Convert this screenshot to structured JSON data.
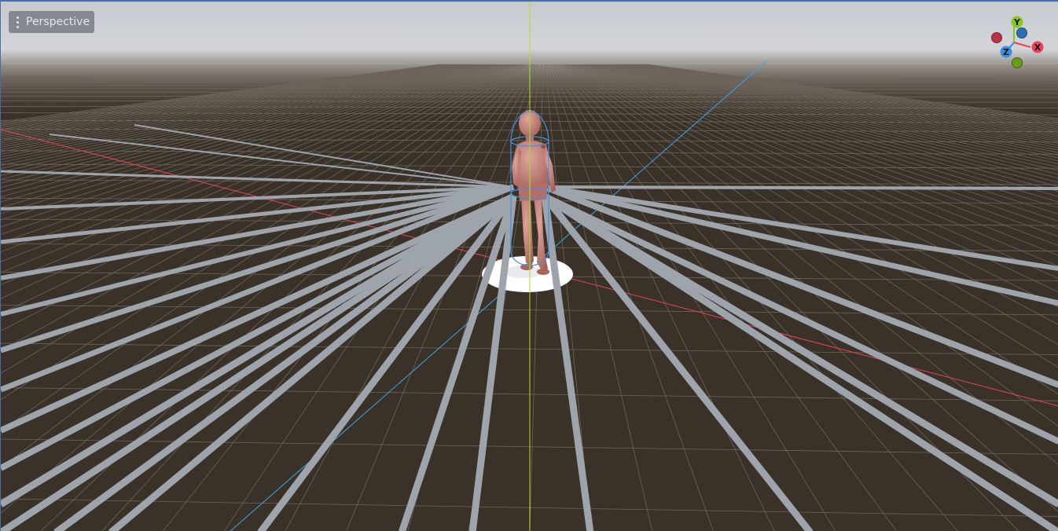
{
  "viewport": {
    "view_menu_label": "Perspective"
  },
  "gizmo": {
    "x_label": "X",
    "y_label": "Y",
    "z_label": "Z",
    "colors": {
      "x": "#e8435a",
      "y": "#8cc425",
      "z": "#3b8fe0",
      "x_neg": "#b8344a",
      "y_neg": "#6a9a1e",
      "z_neg": "#2d6eb0"
    }
  },
  "scene": {
    "sky_color": "#c9ccd2",
    "ground_color": "#3a3128",
    "ray_color": "#9ea4ab",
    "character_color": "#c97f76"
  }
}
